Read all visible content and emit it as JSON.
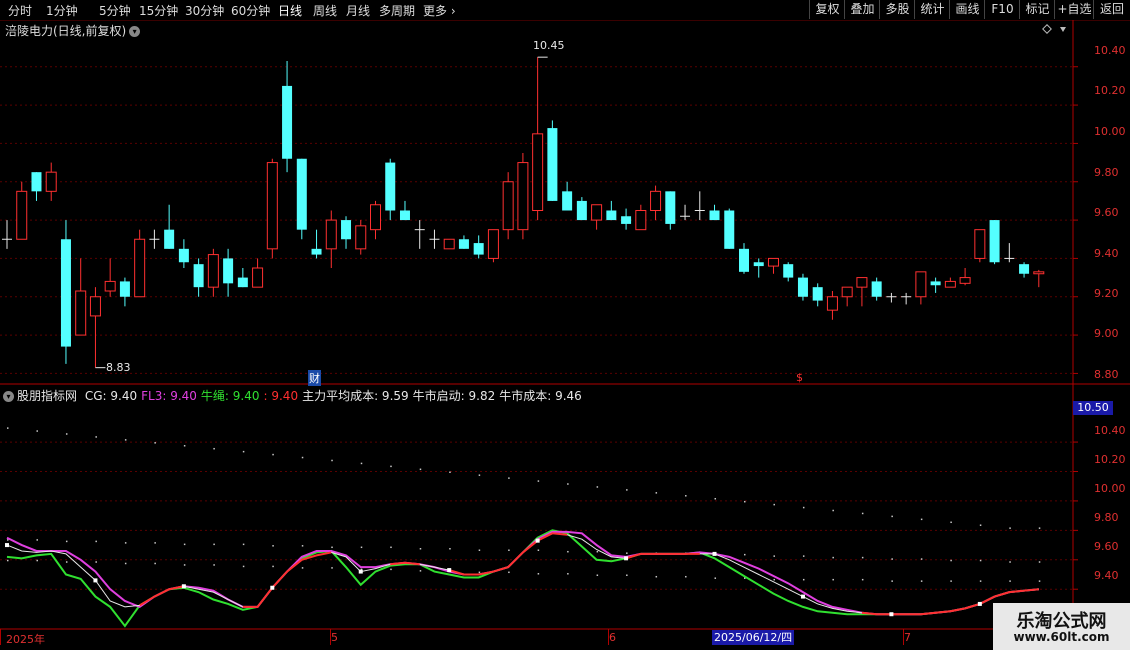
{
  "toolbar": {
    "timeframes": [
      {
        "label": "分时"
      },
      {
        "label": "1分钟"
      },
      {
        "label": "5分钟"
      },
      {
        "label": "15分钟"
      },
      {
        "label": "30分钟"
      },
      {
        "label": "60分钟"
      },
      {
        "label": "日线"
      },
      {
        "label": "周线"
      },
      {
        "label": "月线"
      },
      {
        "label": "多周期"
      },
      {
        "label": "更多"
      }
    ],
    "active_timeframe": "日线",
    "buttons": [
      {
        "label": "复权"
      },
      {
        "label": "叠加"
      },
      {
        "label": "多股"
      },
      {
        "label": "统计"
      },
      {
        "label": "画线"
      },
      {
        "label": "F10"
      },
      {
        "label": "标记"
      },
      {
        "label": "+自选"
      },
      {
        "label": "返回"
      }
    ]
  },
  "stock": {
    "title": "涪陵电力(日线,前复权)"
  },
  "main_chart": {
    "price_axis": [
      "10.40",
      "10.20",
      "10.00",
      "9.80",
      "9.60",
      "9.40",
      "9.20",
      "9.00",
      "8.80"
    ],
    "high_annotation": "10.45",
    "low_annotation": "8.83",
    "markers": {
      "finance": "财",
      "dividend": "$"
    }
  },
  "indicator": {
    "name": "股朋指标网",
    "values": [
      {
        "label": "CG:",
        "value": "9.40",
        "color": "#e8e8e8"
      },
      {
        "label": "FL3:",
        "value": "9.40",
        "color": "#e040e0"
      },
      {
        "label": "牛绳:",
        "value": "9.40",
        "color": "#30e030"
      },
      {
        "label": ":",
        "value": "9.40",
        "color": "#ff3030"
      },
      {
        "label": "主力平均成本:",
        "value": "9.59",
        "color": "#e8e8e8"
      },
      {
        "label": "牛市启动:",
        "value": "9.82",
        "color": "#e8e8e8"
      },
      {
        "label": "牛市成本:",
        "value": "9.46",
        "color": "#e8e8e8"
      }
    ],
    "axis": [
      "10.40",
      "10.20",
      "10.00",
      "9.80",
      "9.60",
      "9.40"
    ],
    "current_price_label": "10.50"
  },
  "date_axis": {
    "ticks": [
      "2025年",
      "5",
      "6",
      "7"
    ],
    "cursor_date": "2025/06/12/四"
  },
  "watermark": {
    "line1": "乐淘公式网",
    "line2": "www.60lt.com"
  },
  "chart_data": {
    "type": "candlestick",
    "title": "涪陵电力(日线,前复权)",
    "ylim": [
      8.75,
      10.55
    ],
    "up_color": "#ff3030",
    "down_color": "#54ffff",
    "candles": [
      {
        "o": 9.5,
        "h": 9.6,
        "l": 9.45,
        "c": 9.5
      },
      {
        "o": 9.5,
        "h": 9.8,
        "l": 9.5,
        "c": 9.75
      },
      {
        "o": 9.85,
        "h": 9.85,
        "l": 9.7,
        "c": 9.75
      },
      {
        "o": 9.75,
        "h": 9.9,
        "l": 9.7,
        "c": 9.85
      },
      {
        "o": 9.5,
        "h": 9.6,
        "l": 8.85,
        "c": 8.94
      },
      {
        "o": 9.0,
        "h": 9.4,
        "l": 9.0,
        "c": 9.23
      },
      {
        "o": 9.1,
        "h": 9.25,
        "l": 8.83,
        "c": 9.2
      },
      {
        "o": 9.23,
        "h": 9.4,
        "l": 9.2,
        "c": 9.28
      },
      {
        "o": 9.28,
        "h": 9.3,
        "l": 9.15,
        "c": 9.2
      },
      {
        "o": 9.2,
        "h": 9.55,
        "l": 9.2,
        "c": 9.5
      },
      {
        "o": 9.5,
        "h": 9.55,
        "l": 9.45,
        "c": 9.5
      },
      {
        "o": 9.55,
        "h": 9.68,
        "l": 9.45,
        "c": 9.45
      },
      {
        "o": 9.45,
        "h": 9.5,
        "l": 9.35,
        "c": 9.38
      },
      {
        "o": 9.37,
        "h": 9.4,
        "l": 9.2,
        "c": 9.25
      },
      {
        "o": 9.25,
        "h": 9.45,
        "l": 9.2,
        "c": 9.42
      },
      {
        "o": 9.4,
        "h": 9.45,
        "l": 9.2,
        "c": 9.27
      },
      {
        "o": 9.3,
        "h": 9.35,
        "l": 9.25,
        "c": 9.25
      },
      {
        "o": 9.25,
        "h": 9.4,
        "l": 9.25,
        "c": 9.35
      },
      {
        "o": 9.45,
        "h": 9.92,
        "l": 9.4,
        "c": 9.9
      },
      {
        "o": 10.3,
        "h": 10.43,
        "l": 9.85,
        "c": 9.92
      },
      {
        "o": 9.92,
        "h": 9.92,
        "l": 9.5,
        "c": 9.55
      },
      {
        "o": 9.45,
        "h": 9.55,
        "l": 9.4,
        "c": 9.42
      },
      {
        "o": 9.45,
        "h": 9.65,
        "l": 9.35,
        "c": 9.6
      },
      {
        "o": 9.6,
        "h": 9.62,
        "l": 9.45,
        "c": 9.5
      },
      {
        "o": 9.45,
        "h": 9.6,
        "l": 9.42,
        "c": 9.57
      },
      {
        "o": 9.55,
        "h": 9.7,
        "l": 9.5,
        "c": 9.68
      },
      {
        "o": 9.9,
        "h": 9.92,
        "l": 9.6,
        "c": 9.65
      },
      {
        "o": 9.65,
        "h": 9.7,
        "l": 9.6,
        "c": 9.6
      },
      {
        "o": 9.55,
        "h": 9.6,
        "l": 9.45,
        "c": 9.55
      },
      {
        "o": 9.5,
        "h": 9.55,
        "l": 9.45,
        "c": 9.5
      },
      {
        "o": 9.45,
        "h": 9.5,
        "l": 9.45,
        "c": 9.5
      },
      {
        "o": 9.5,
        "h": 9.52,
        "l": 9.45,
        "c": 9.45
      },
      {
        "o": 9.48,
        "h": 9.52,
        "l": 9.4,
        "c": 9.42
      },
      {
        "o": 9.4,
        "h": 9.55,
        "l": 9.38,
        "c": 9.55
      },
      {
        "o": 9.55,
        "h": 9.85,
        "l": 9.5,
        "c": 9.8
      },
      {
        "o": 9.55,
        "h": 9.95,
        "l": 9.5,
        "c": 9.9
      },
      {
        "o": 9.65,
        "h": 10.45,
        "l": 9.6,
        "c": 10.05
      },
      {
        "o": 10.08,
        "h": 10.12,
        "l": 9.7,
        "c": 9.7
      },
      {
        "o": 9.75,
        "h": 9.8,
        "l": 9.65,
        "c": 9.65
      },
      {
        "o": 9.7,
        "h": 9.72,
        "l": 9.6,
        "c": 9.6
      },
      {
        "o": 9.6,
        "h": 9.68,
        "l": 9.55,
        "c": 9.68
      },
      {
        "o": 9.65,
        "h": 9.7,
        "l": 9.6,
        "c": 9.6
      },
      {
        "o": 9.62,
        "h": 9.66,
        "l": 9.55,
        "c": 9.58
      },
      {
        "o": 9.55,
        "h": 9.68,
        "l": 9.55,
        "c": 9.65
      },
      {
        "o": 9.65,
        "h": 9.78,
        "l": 9.6,
        "c": 9.75
      },
      {
        "o": 9.75,
        "h": 9.75,
        "l": 9.55,
        "c": 9.58
      },
      {
        "o": 9.62,
        "h": 9.68,
        "l": 9.6,
        "c": 9.62
      },
      {
        "o": 9.65,
        "h": 9.75,
        "l": 9.6,
        "c": 9.65
      },
      {
        "o": 9.65,
        "h": 9.68,
        "l": 9.6,
        "c": 9.6
      },
      {
        "o": 9.65,
        "h": 9.66,
        "l": 9.45,
        "c": 9.45
      },
      {
        "o": 9.45,
        "h": 9.48,
        "l": 9.32,
        "c": 9.33
      },
      {
        "o": 9.38,
        "h": 9.4,
        "l": 9.3,
        "c": 9.36
      },
      {
        "o": 9.36,
        "h": 9.4,
        "l": 9.32,
        "c": 9.4
      },
      {
        "o": 9.37,
        "h": 9.38,
        "l": 9.28,
        "c": 9.3
      },
      {
        "o": 9.3,
        "h": 9.32,
        "l": 9.18,
        "c": 9.2
      },
      {
        "o": 9.25,
        "h": 9.27,
        "l": 9.15,
        "c": 9.18
      },
      {
        "o": 9.13,
        "h": 9.23,
        "l": 9.08,
        "c": 9.2
      },
      {
        "o": 9.2,
        "h": 9.25,
        "l": 9.15,
        "c": 9.25
      },
      {
        "o": 9.25,
        "h": 9.3,
        "l": 9.15,
        "c": 9.3
      },
      {
        "o": 9.28,
        "h": 9.3,
        "l": 9.18,
        "c": 9.2
      },
      {
        "o": 9.2,
        "h": 9.22,
        "l": 9.17,
        "c": 9.2
      },
      {
        "o": 9.2,
        "h": 9.22,
        "l": 9.16,
        "c": 9.2
      },
      {
        "o": 9.2,
        "h": 9.33,
        "l": 9.16,
        "c": 9.33
      },
      {
        "o": 9.28,
        "h": 9.3,
        "l": 9.22,
        "c": 9.26
      },
      {
        "o": 9.25,
        "h": 9.3,
        "l": 9.25,
        "c": 9.28
      },
      {
        "o": 9.27,
        "h": 9.35,
        "l": 9.26,
        "c": 9.3
      },
      {
        "o": 9.4,
        "h": 9.55,
        "l": 9.38,
        "c": 9.55
      },
      {
        "o": 9.6,
        "h": 9.6,
        "l": 9.37,
        "c": 9.38
      },
      {
        "o": 9.4,
        "h": 9.48,
        "l": 9.38,
        "c": 9.4
      },
      {
        "o": 9.37,
        "h": 9.38,
        "l": 9.3,
        "c": 9.32
      },
      {
        "o": 9.32,
        "h": 9.34,
        "l": 9.25,
        "c": 9.33
      }
    ],
    "indicator_ylim": [
      9.15,
      10.55
    ],
    "series": [
      {
        "name": "CG",
        "color": "#e8e8e8",
        "values": [
          9.7,
          9.66,
          9.65,
          9.66,
          9.64,
          9.55,
          9.46,
          9.32,
          9.28,
          9.29,
          9.35,
          9.4,
          9.42,
          9.4,
          9.38,
          9.33,
          9.28,
          9.28,
          9.41,
          9.52,
          9.6,
          9.63,
          9.65,
          9.62,
          9.52,
          9.54,
          9.57,
          9.58,
          9.57,
          9.55,
          9.53,
          9.5,
          9.5,
          9.52,
          9.55,
          9.65,
          9.73,
          9.78,
          9.77,
          9.74,
          9.67,
          9.62,
          9.61,
          9.64,
          9.64,
          9.64,
          9.64,
          9.64,
          9.64,
          9.6,
          9.55,
          9.5,
          9.45,
          9.4,
          9.35,
          9.3,
          9.27,
          9.25,
          9.24,
          9.23,
          9.23,
          9.23,
          9.23,
          9.24,
          9.25,
          9.27,
          9.3,
          9.35,
          9.38,
          9.39,
          9.4
        ]
      },
      {
        "name": "FL3",
        "color": "#e040e0",
        "values": [
          9.75,
          9.7,
          9.66,
          9.66,
          9.66,
          9.6,
          9.52,
          9.4,
          9.32,
          9.28,
          9.35,
          9.4,
          9.42,
          9.41,
          9.39,
          9.33,
          9.28,
          9.28,
          9.41,
          9.52,
          9.62,
          9.66,
          9.66,
          9.63,
          9.55,
          9.55,
          9.57,
          9.58,
          9.57,
          9.55,
          9.52,
          9.5,
          9.5,
          9.52,
          9.55,
          9.65,
          9.74,
          9.79,
          9.79,
          9.78,
          9.7,
          9.63,
          9.62,
          9.64,
          9.64,
          9.64,
          9.64,
          9.65,
          9.64,
          9.62,
          9.58,
          9.54,
          9.49,
          9.44,
          9.38,
          9.32,
          9.28,
          9.26,
          9.24,
          9.23,
          9.23,
          9.23,
          9.23,
          9.24,
          9.25,
          9.27,
          9.3,
          9.35,
          9.38,
          9.39,
          9.4
        ]
      },
      {
        "name": "牛绳",
        "color": "#30e030",
        "values": [
          9.62,
          9.61,
          9.63,
          9.64,
          9.5,
          9.47,
          9.35,
          9.28,
          9.15,
          9.29,
          9.35,
          9.4,
          9.41,
          9.38,
          9.33,
          9.3,
          9.26,
          9.28,
          9.41,
          9.52,
          9.61,
          9.65,
          9.66,
          9.55,
          9.43,
          9.52,
          9.56,
          9.57,
          9.57,
          9.52,
          9.5,
          9.48,
          9.48,
          9.52,
          9.55,
          9.65,
          9.75,
          9.8,
          9.78,
          9.69,
          9.6,
          9.59,
          9.61,
          9.64,
          9.64,
          9.64,
          9.64,
          9.65,
          9.61,
          9.55,
          9.49,
          9.43,
          9.37,
          9.32,
          9.28,
          9.25,
          9.24,
          9.23,
          9.23,
          9.23,
          9.23,
          9.23,
          9.23,
          9.24,
          9.25,
          9.27,
          9.3,
          9.35,
          9.38,
          9.39,
          9.4
        ]
      },
      {
        "name": "牛市启动",
        "color": "#c8c8c8",
        "values": [
          10.5,
          10.49,
          10.48,
          10.47,
          10.46,
          10.45,
          10.44,
          10.43,
          10.42,
          10.41,
          10.4,
          10.39,
          10.38,
          10.37,
          10.36,
          10.35,
          10.34,
          10.33,
          10.32,
          10.31,
          10.3,
          10.29,
          10.28,
          10.27,
          10.26,
          10.25,
          10.24,
          10.23,
          10.22,
          10.21,
          10.2,
          10.19,
          10.18,
          10.17,
          10.16,
          10.15,
          10.14,
          10.13,
          10.12,
          10.11,
          10.1,
          10.09,
          10.08,
          10.07,
          10.06,
          10.05,
          10.04,
          10.03,
          10.02,
          10.01,
          10.0,
          9.99,
          9.98,
          9.97,
          9.96,
          9.95,
          9.94,
          9.93,
          9.92,
          9.91,
          9.9,
          9.89,
          9.88,
          9.87,
          9.86,
          9.85,
          9.84,
          9.83,
          9.82,
          9.82,
          9.82
        ]
      },
      {
        "name": "主力平均成本",
        "color": "#c8c8c8",
        "values": [
          9.74,
          9.74,
          9.74,
          9.74,
          9.73,
          9.73,
          9.73,
          9.72,
          9.72,
          9.72,
          9.72,
          9.72,
          9.71,
          9.71,
          9.71,
          9.71,
          9.71,
          9.7,
          9.7,
          9.7,
          9.7,
          9.7,
          9.69,
          9.69,
          9.69,
          9.69,
          9.69,
          9.68,
          9.68,
          9.68,
          9.68,
          9.68,
          9.67,
          9.67,
          9.67,
          9.67,
          9.67,
          9.66,
          9.66,
          9.66,
          9.66,
          9.66,
          9.65,
          9.65,
          9.65,
          9.65,
          9.65,
          9.64,
          9.64,
          9.64,
          9.64,
          9.63,
          9.63,
          9.63,
          9.63,
          9.62,
          9.62,
          9.62,
          9.62,
          9.61,
          9.61,
          9.61,
          9.61,
          9.6,
          9.6,
          9.6,
          9.6,
          9.59,
          9.59,
          9.59,
          9.59
        ]
      },
      {
        "name": "牛市成本",
        "color": "#c8c8c8",
        "values": [
          9.6,
          9.6,
          9.6,
          9.6,
          9.59,
          9.59,
          9.59,
          9.59,
          9.58,
          9.58,
          9.58,
          9.58,
          9.57,
          9.57,
          9.57,
          9.57,
          9.56,
          9.56,
          9.56,
          9.56,
          9.55,
          9.55,
          9.55,
          9.55,
          9.54,
          9.54,
          9.54,
          9.54,
          9.53,
          9.53,
          9.53,
          9.53,
          9.52,
          9.52,
          9.52,
          9.52,
          9.51,
          9.51,
          9.51,
          9.51,
          9.5,
          9.5,
          9.5,
          9.5,
          9.49,
          9.49,
          9.49,
          9.49,
          9.48,
          9.48,
          9.48,
          9.48,
          9.47,
          9.47,
          9.47,
          9.47,
          9.47,
          9.47,
          9.47,
          9.46,
          9.46,
          9.46,
          9.46,
          9.46,
          9.46,
          9.46,
          9.46,
          9.46,
          9.46,
          9.46,
          9.46
        ]
      }
    ]
  }
}
